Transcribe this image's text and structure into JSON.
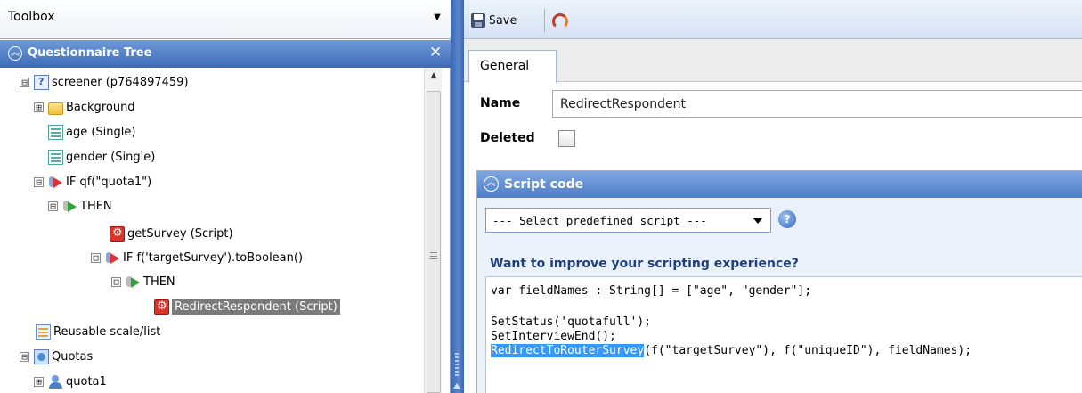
{
  "toolbox": {
    "label": "Toolbox",
    "dropdown_icon": "dropdown-arrow-icon"
  },
  "questionnaire_tree": {
    "title": "Questionnaire Tree",
    "nodes": [
      {
        "label": "screener (p764897459)",
        "expander": "⊟",
        "icon": "survey-icon"
      },
      {
        "label": "Background",
        "expander": "⊞",
        "icon": "folder-icon"
      },
      {
        "label": "age (Single)",
        "expander": "",
        "icon": "single-question-icon"
      },
      {
        "label": "gender (Single)",
        "expander": "",
        "icon": "single-question-icon"
      },
      {
        "label": "IF qf(\"quota1\")",
        "expander": "⊟",
        "icon": "if-condition-icon"
      },
      {
        "label": "THEN",
        "expander": "⊟",
        "icon": "then-branch-icon"
      },
      {
        "label": "getSurvey (Script)",
        "expander": "",
        "icon": "script-icon"
      },
      {
        "label": "IF f('targetSurvey').toBoolean()",
        "expander": "⊟",
        "icon": "if-condition-icon"
      },
      {
        "label": "THEN",
        "expander": "⊟",
        "icon": "then-branch-icon"
      },
      {
        "label": "RedirectRespondent (Script)",
        "expander": "",
        "icon": "script-icon",
        "selected": true
      },
      {
        "label": "Reusable scale/list",
        "expander": "",
        "icon": "reusable-list-icon"
      },
      {
        "label": "Quotas",
        "expander": "⊟",
        "icon": "quotas-icon"
      },
      {
        "label": "quota1",
        "expander": "⊞",
        "icon": "quota-icon"
      }
    ]
  },
  "toolbar": {
    "save_label": "Save"
  },
  "tabs": {
    "general": "General"
  },
  "form": {
    "name_label": "Name",
    "name_value": "RedirectRespondent",
    "deleted_label": "Deleted",
    "deleted_checked": false
  },
  "script_code": {
    "title": "Script code",
    "predefined_select": "--- Select predefined script ---",
    "improve_text": "Want to improve your scripting experience?",
    "lines": {
      "l1": "var fieldNames : String[] = [\"age\", \"gender\"];",
      "l3": "SetStatus('quotafull');",
      "l4": "SetInterviewEnd();",
      "l5_highlight": "RedirectToRouterSurvey",
      "l5_rest": "(f(\"targetSurvey\"), f(\"uniqueID\"), fieldNames);"
    }
  }
}
